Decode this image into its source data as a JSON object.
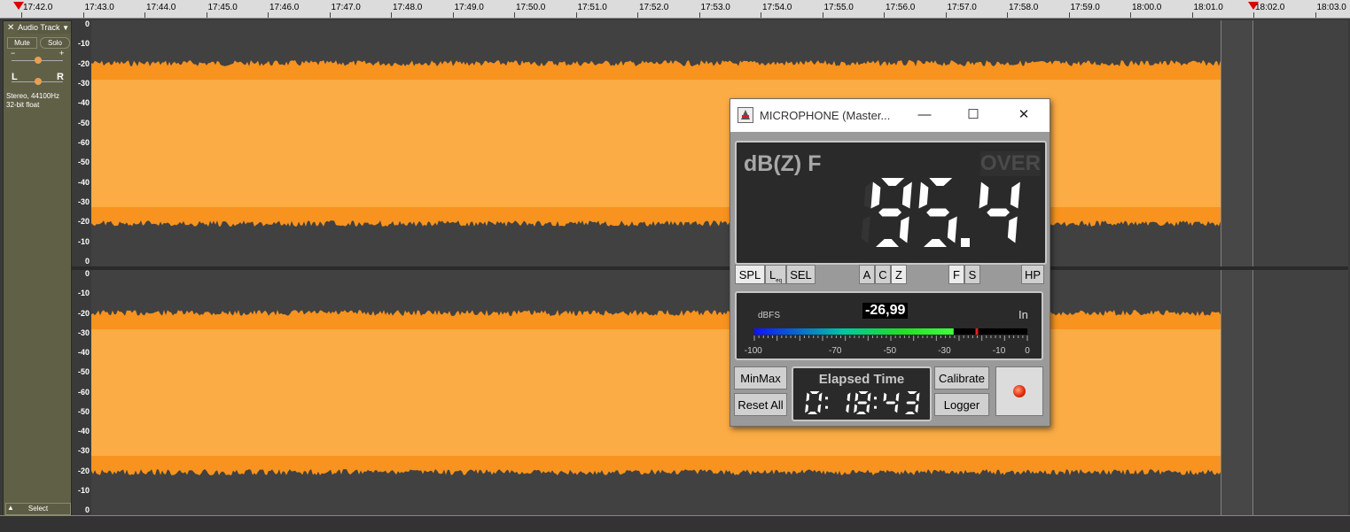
{
  "timeline": {
    "labels": [
      "17:42.0",
      "17:43.0",
      "17:44.0",
      "17:45.0",
      "17:46.0",
      "17:47.0",
      "17:48.0",
      "17:49.0",
      "17:50.0",
      "17:51.0",
      "17:52.0",
      "17:53.0",
      "17:54.0",
      "17:55.0",
      "17:56.0",
      "17:57.0",
      "17:58.0",
      "17:59.0",
      "18:00.0",
      "18:01.0",
      "18:02.0",
      "18:03.0"
    ]
  },
  "track": {
    "close": "✕",
    "name": "Audio Track",
    "dropdown": "▼",
    "mute": "Mute",
    "solo": "Solo",
    "gain_minus": "−",
    "gain_plus": "+",
    "pan_left": "L",
    "pan_right": "R",
    "info_line1": "Stereo, 44100Hz",
    "info_line2": "32-bit float",
    "select": "Select",
    "collapse": "▲"
  },
  "scale": {
    "labels": [
      "0",
      "-10",
      "-20",
      "-30",
      "-40",
      "-50",
      "-60",
      "-50",
      "-40",
      "-30",
      "-20",
      "-10",
      "0"
    ]
  },
  "waveform": {
    "color": "#f7931e",
    "inner_color": "#fbac44"
  },
  "meter": {
    "title": "MICROPHONE (Master...",
    "minimize": "—",
    "maximize": "☐",
    "close": "✕",
    "weighting": "dB(Z) F",
    "over": "OVER",
    "reading": "95.4",
    "buttons": {
      "spl": "SPL",
      "leq": "L",
      "leq_sub": "eq",
      "sel": "SEL",
      "a": "A",
      "c": "C",
      "z": "Z",
      "f": "F",
      "s": "S",
      "hp": "HP"
    },
    "level_unit": "dBFS",
    "level_value": "-26,99",
    "input_label": "In",
    "level_fraction": 0.73,
    "peak_fraction": 0.81,
    "bar_scale": [
      "-100",
      "-70",
      "-50",
      "-30",
      "-10",
      "0"
    ],
    "minmax": "MinMax",
    "reset_all": "Reset All",
    "elapsed_label": "Elapsed Time",
    "elapsed_value": "0:18:43",
    "calibrate": "Calibrate",
    "logger": "Logger"
  }
}
